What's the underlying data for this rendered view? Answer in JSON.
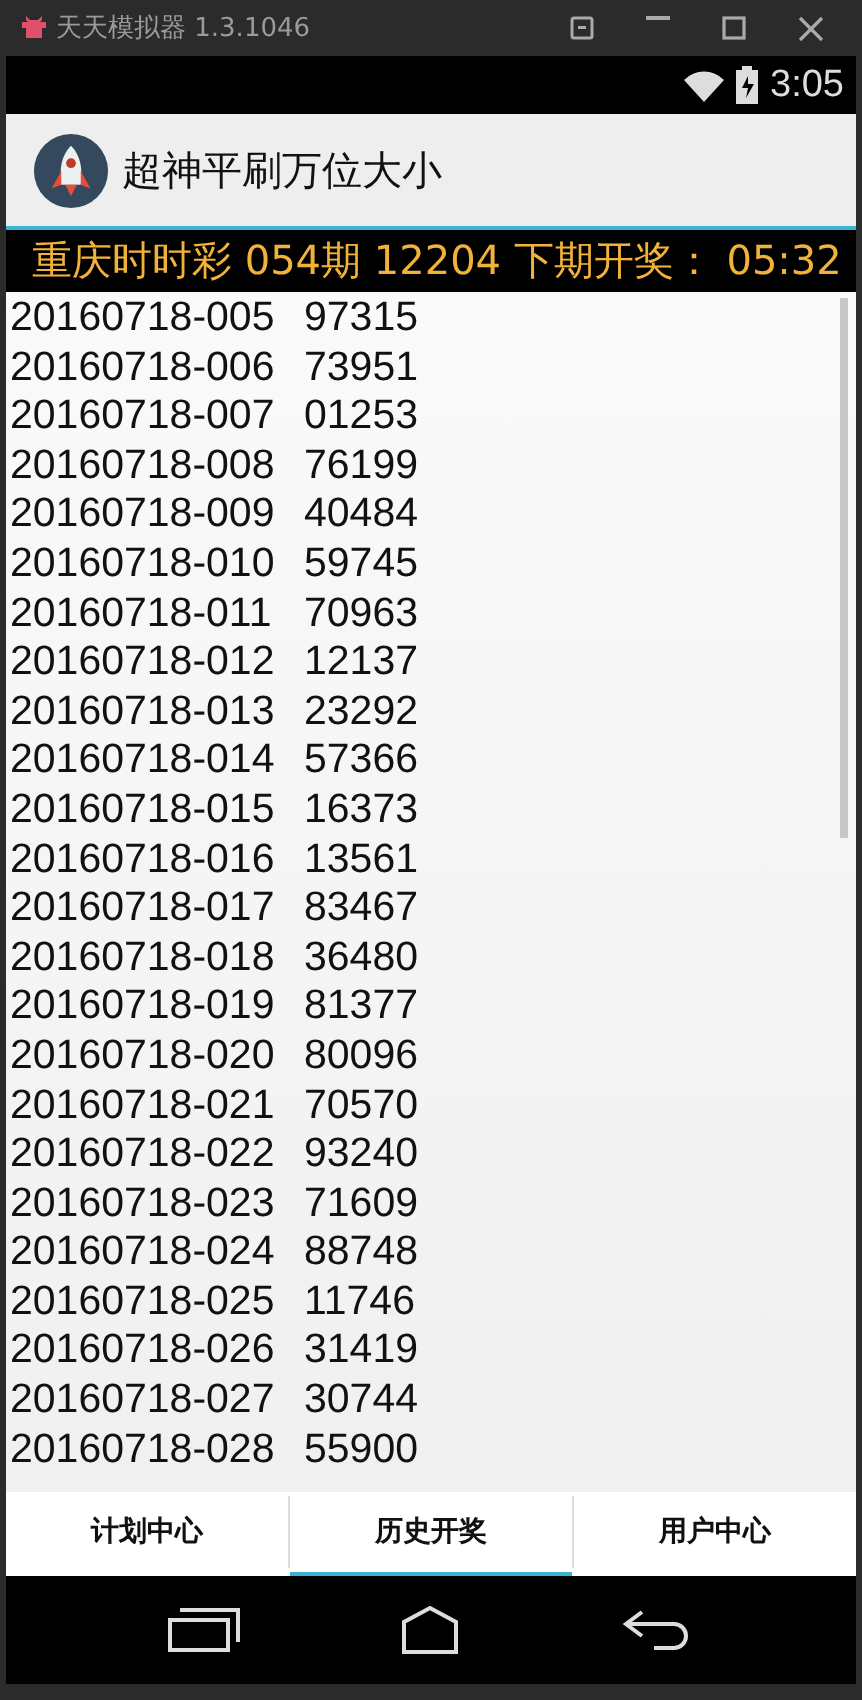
{
  "emulator": {
    "title": "天天模拟器 1.3.1046"
  },
  "status_bar": {
    "time": "3:05"
  },
  "app_bar": {
    "title": "超神平刷万位大小"
  },
  "ticker": {
    "text": "重庆时时彩 054期 12204 下期开奖： 05:32"
  },
  "draws": [
    {
      "issue": "20160718-005",
      "number": "97315"
    },
    {
      "issue": "20160718-006",
      "number": "73951"
    },
    {
      "issue": "20160718-007",
      "number": "01253"
    },
    {
      "issue": "20160718-008",
      "number": "76199"
    },
    {
      "issue": "20160718-009",
      "number": "40484"
    },
    {
      "issue": "20160718-010",
      "number": "59745"
    },
    {
      "issue": "20160718-011",
      "number": "70963"
    },
    {
      "issue": "20160718-012",
      "number": "12137"
    },
    {
      "issue": "20160718-013",
      "number": "23292"
    },
    {
      "issue": "20160718-014",
      "number": "57366"
    },
    {
      "issue": "20160718-015",
      "number": "16373"
    },
    {
      "issue": "20160718-016",
      "number": "13561"
    },
    {
      "issue": "20160718-017",
      "number": "83467"
    },
    {
      "issue": "20160718-018",
      "number": "36480"
    },
    {
      "issue": "20160718-019",
      "number": "81377"
    },
    {
      "issue": "20160718-020",
      "number": "80096"
    },
    {
      "issue": "20160718-021",
      "number": "70570"
    },
    {
      "issue": "20160718-022",
      "number": "93240"
    },
    {
      "issue": "20160718-023",
      "number": "71609"
    },
    {
      "issue": "20160718-024",
      "number": "88748"
    },
    {
      "issue": "20160718-025",
      "number": "11746"
    },
    {
      "issue": "20160718-026",
      "number": "31419"
    },
    {
      "issue": "20160718-027",
      "number": "30744"
    },
    {
      "issue": "20160718-028",
      "number": "55900"
    }
  ],
  "tabs": [
    {
      "label": "计划中心",
      "selected": false
    },
    {
      "label": "历史开奖",
      "selected": true
    },
    {
      "label": "用户中心",
      "selected": false
    }
  ]
}
